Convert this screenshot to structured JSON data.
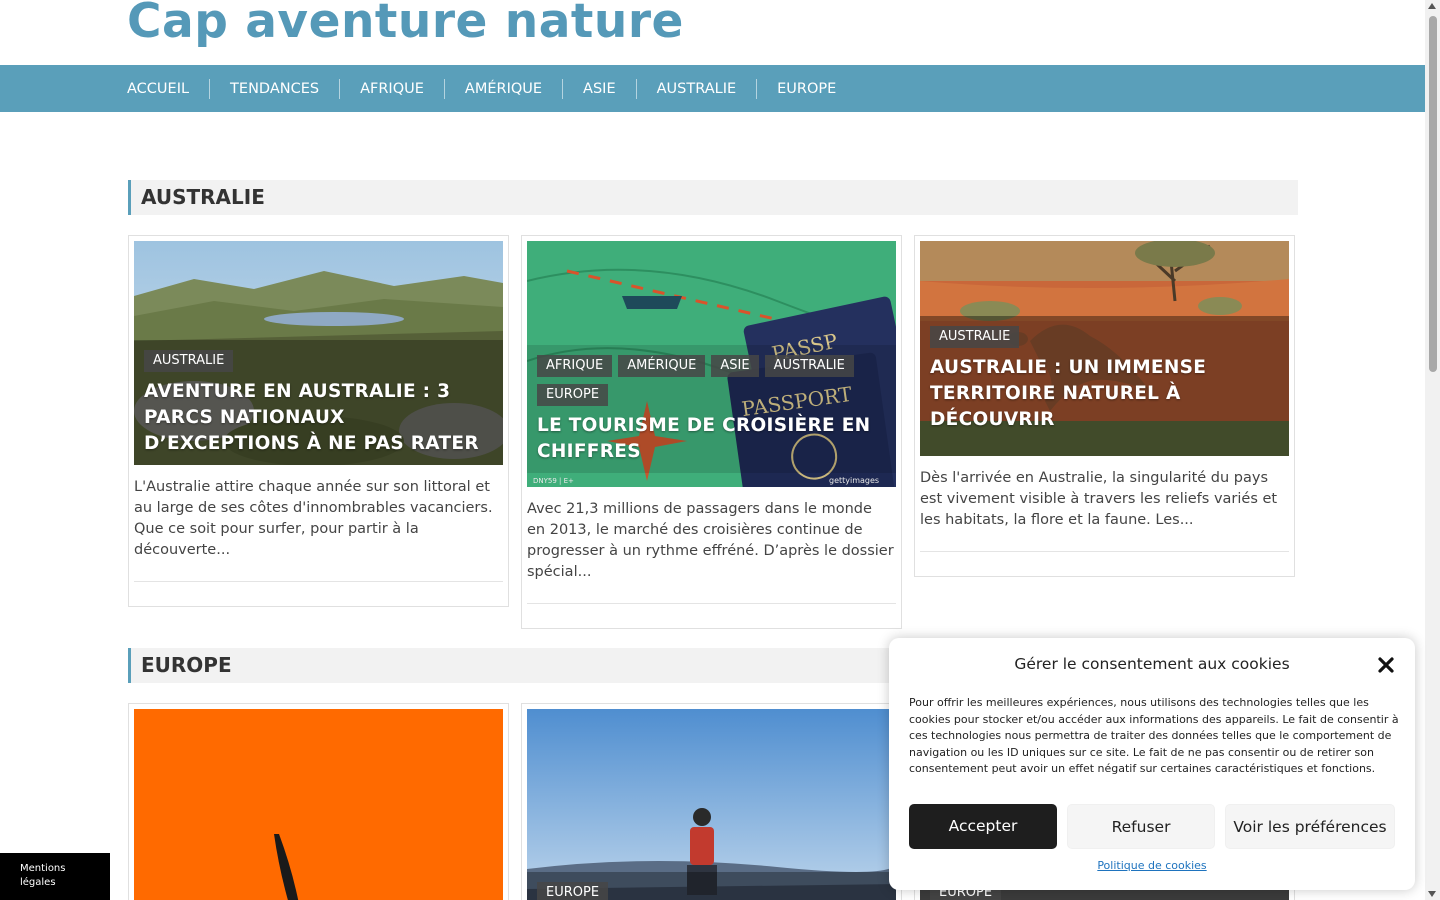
{
  "site": {
    "title": "Cap aventure nature"
  },
  "nav": {
    "items": [
      "ACCUEIL",
      "TENDANCES",
      "AFRIQUE",
      "AMÉRIQUE",
      "ASIE",
      "AUSTRALIE",
      "EUROPE"
    ]
  },
  "sections": [
    {
      "heading": "AUSTRALIE",
      "cards": [
        {
          "tags": [
            "AUSTRALIE"
          ],
          "title": "AVENTURE EN AUSTRALIE : 3 PARCS NATIONAUX D’EXCEPTIONS À NE PAS RATER",
          "excerpt": "L'Australie attire chaque année sur son littoral et au large de ses côtes d'innombrables vacanciers. Que ce soit pour surfer, pour partir à la découverte..."
        },
        {
          "tags": [
            "AFRIQUE",
            "AMÉRIQUE",
            "ASIE",
            "AUSTRALIE",
            "EUROPE"
          ],
          "title": "LE TOURISME DE CROISIÈRE EN CHIFFRES",
          "excerpt": "Avec 21,3 millions de passagers dans le monde en 2013, le marché des croisières continue de progresser à un rythme effréné. D’après le dossier spécial...",
          "image_credit_left": "DNY59 | E+",
          "image_credit_right": "gettyimages"
        },
        {
          "tags": [
            "AUSTRALIE"
          ],
          "title": "AUSTRALIE : UN IMMENSE TERRITOIRE NATUREL À DÉCOUVRIR",
          "excerpt": "Dès l'arrivée en Australie, la singularité du pays est vivement visible  à travers les reliefs variés et les habitats, la flore et la faune. Les..."
        }
      ]
    },
    {
      "heading": "EUROPE",
      "cards": [
        {
          "tags": []
        },
        {
          "tags": [
            "EUROPE"
          ]
        },
        {
          "tags": [
            "EUROPE"
          ]
        }
      ]
    }
  ],
  "cookie": {
    "title": "Gérer le consentement aux cookies",
    "text": "Pour offrir les meilleures expériences, nous utilisons des technologies telles que les cookies pour stocker et/ou accéder aux informations des appareils. Le fait de consentir à ces technologies nous permettra de traiter des données telles que le comportement de navigation ou les ID uniques sur ce site. Le fait de ne pas consentir ou de retirer son consentement peut avoir un effet négatif sur certaines caractéristiques et fonctions.",
    "accept_label": "Accepter",
    "refuse_label": "Refuser",
    "prefs_label": "Voir les préférences",
    "policy_link": "Politique de cookies",
    "close_icon": "close-icon"
  },
  "footer_widget": {
    "label": "Mentions légales"
  },
  "colors": {
    "accent": "#5a9fba",
    "title": "#5599b8",
    "dark_button": "#1e1e1e",
    "link": "#1e73be"
  }
}
